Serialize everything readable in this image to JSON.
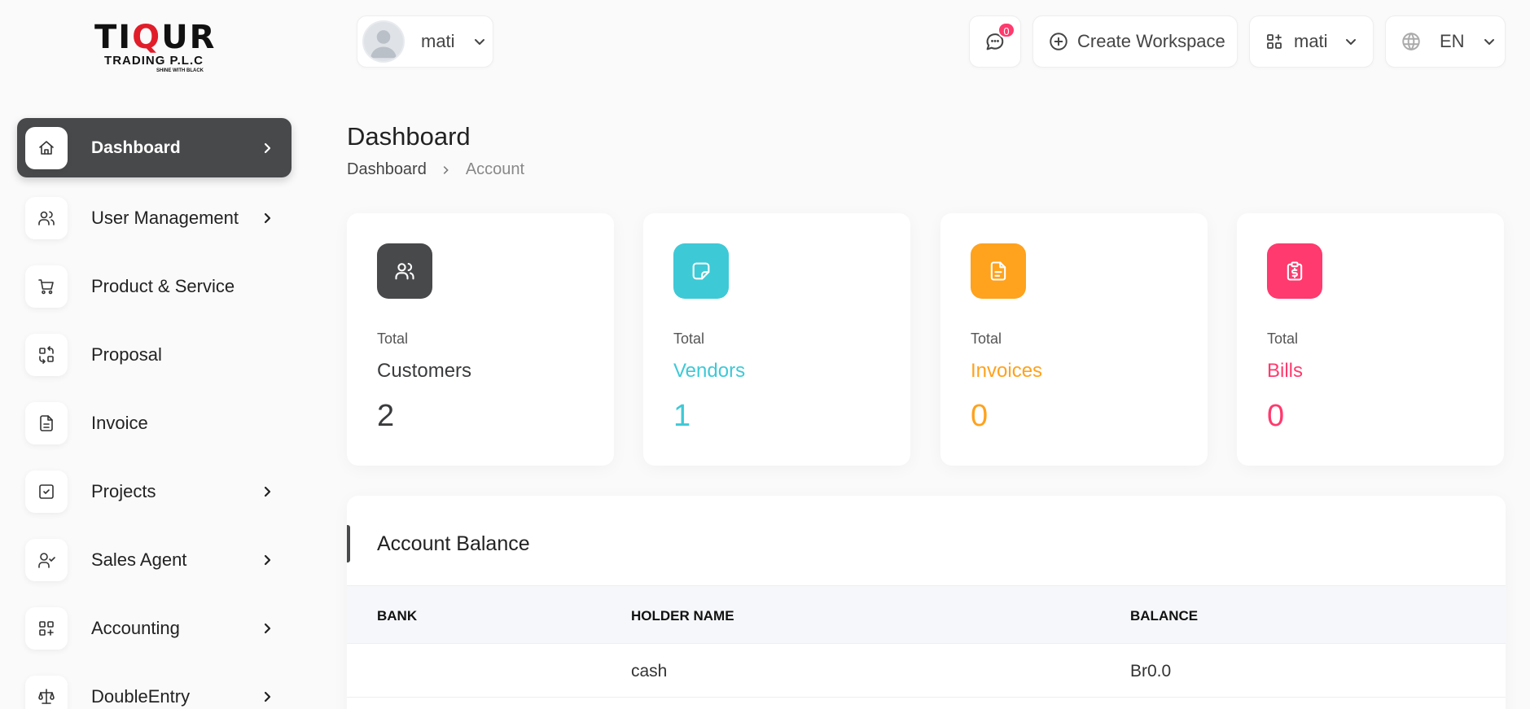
{
  "logo": {
    "main_pre": "TI",
    "main_q": "Q",
    "main_post": "UR",
    "sub": "TRADING P.L.C",
    "tagline": "SHINE WITH BLACK"
  },
  "sidebar": {
    "items": [
      {
        "label": "Dashboard",
        "icon": "home-icon",
        "active": true,
        "has_chevron": true
      },
      {
        "label": "User Management",
        "icon": "users-icon",
        "has_chevron": true
      },
      {
        "label": "Product & Service",
        "icon": "cart-icon",
        "has_chevron": false
      },
      {
        "label": "Proposal",
        "icon": "exchange-icon",
        "has_chevron": false
      },
      {
        "label": "Invoice",
        "icon": "file-invoice-icon",
        "has_chevron": false
      },
      {
        "label": "Projects",
        "icon": "checkbox-icon",
        "has_chevron": true
      },
      {
        "label": "Sales Agent",
        "icon": "user-check-icon",
        "has_chevron": true
      },
      {
        "label": "Accounting",
        "icon": "apps-icon",
        "has_chevron": true
      },
      {
        "label": "DoubleEntry",
        "icon": "scale-icon",
        "has_chevron": true
      }
    ]
  },
  "header": {
    "user": {
      "name": "mati"
    },
    "messages": {
      "badge": "0"
    },
    "create_workspace": {
      "label": "Create Workspace"
    },
    "workspace": {
      "name": "mati"
    },
    "language": {
      "code": "EN"
    }
  },
  "page": {
    "title": "Dashboard",
    "breadcrumb": [
      "Dashboard",
      "Account"
    ]
  },
  "cards": [
    {
      "pre": "Total",
      "name": "Customers",
      "value": "2",
      "color": "#48494b",
      "text_color": "#3a3b3d",
      "icon": "users-icon"
    },
    {
      "pre": "Total",
      "name": "Vendors",
      "value": "1",
      "color": "#3ec9d6",
      "text_color": "#3ec9d6",
      "icon": "note-icon"
    },
    {
      "pre": "Total",
      "name": "Invoices",
      "value": "0",
      "color": "#ffa21d",
      "text_color": "#ffa21d",
      "icon": "file-invoice-icon"
    },
    {
      "pre": "Total",
      "name": "Bills",
      "value": "0",
      "color": "#ff3a6e",
      "text_color": "#ff3a6e",
      "icon": "clipboard-dollar-icon"
    }
  ],
  "account_balance": {
    "title": "Account Balance",
    "columns": [
      "BANK",
      "HOLDER NAME",
      "BALANCE"
    ],
    "rows": [
      {
        "bank": "",
        "holder": "cash",
        "balance": "Br0.0"
      }
    ]
  }
}
